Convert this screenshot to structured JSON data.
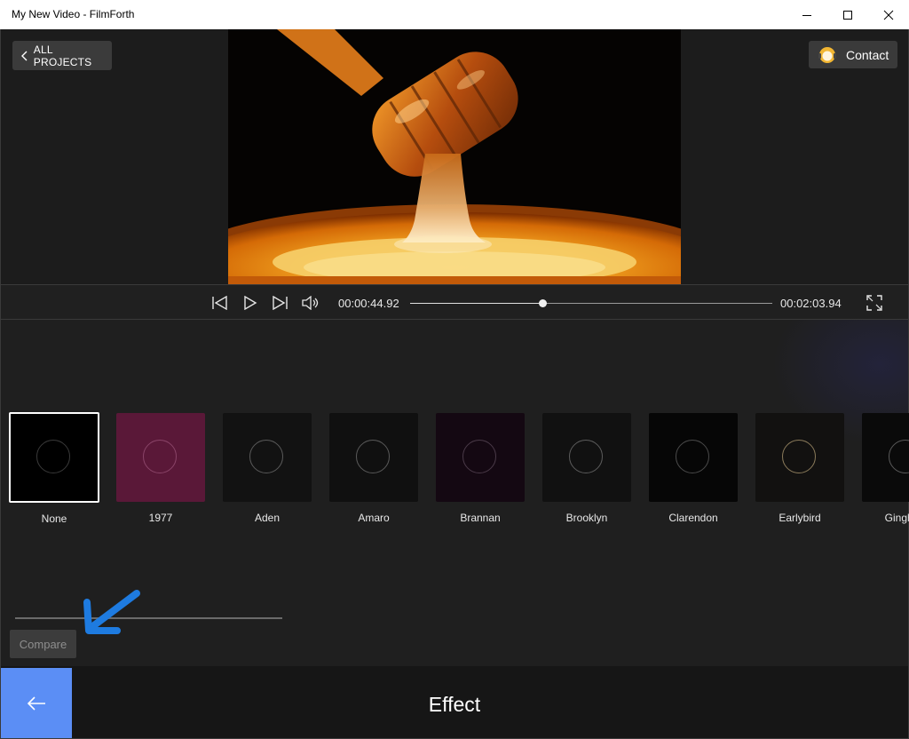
{
  "window": {
    "title": "My New Video - FilmForth"
  },
  "header": {
    "all_projects_label": "ALL PROJECTS",
    "contact_label": "Contact"
  },
  "player": {
    "current_time": "00:00:44.92",
    "total_time": "00:02:03.94",
    "progress": 0.365
  },
  "filters": {
    "items": [
      {
        "label": "None",
        "swatch": "#000000",
        "ring": "#3a3a3a",
        "selected": true
      },
      {
        "label": "1977",
        "swatch": "#5a1838",
        "ring": "#8a4468",
        "selected": false
      },
      {
        "label": "Aden",
        "swatch": "#121212",
        "ring": "#5a5a5a",
        "selected": false
      },
      {
        "label": "Amaro",
        "swatch": "#101010",
        "ring": "#5a5a5a",
        "selected": false
      },
      {
        "label": "Brannan",
        "swatch": "#140812",
        "ring": "#4a3a48",
        "selected": false
      },
      {
        "label": "Brooklyn",
        "swatch": "#111111",
        "ring": "#5c5c5c",
        "selected": false
      },
      {
        "label": "Clarendon",
        "swatch": "#060606",
        "ring": "#4a4a4a",
        "selected": false
      },
      {
        "label": "Earlybird",
        "swatch": "#121110",
        "ring": "#8a7a5a",
        "selected": false
      },
      {
        "label": "Gingham",
        "swatch": "#0a0a0a",
        "ring": "#5a5a5a",
        "selected": false
      }
    ]
  },
  "compare_label": "Compare",
  "bottom": {
    "title": "Effect"
  },
  "colors": {
    "accent": "#5b8ef5",
    "annotation_arrow": "#1e7be0"
  }
}
